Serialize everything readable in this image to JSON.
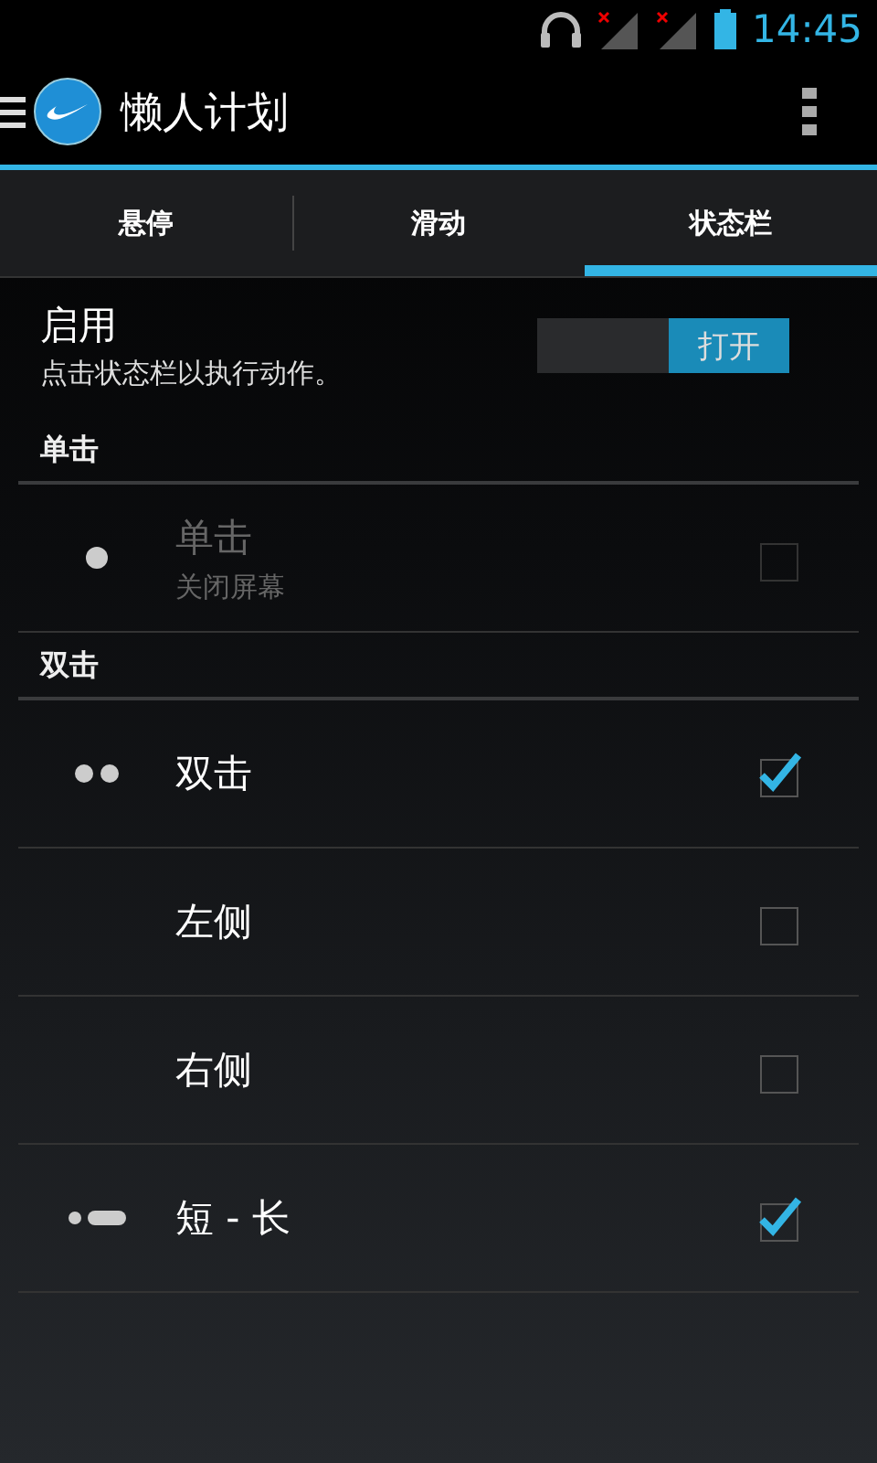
{
  "status_bar": {
    "time": "14:45"
  },
  "action_bar": {
    "title": "懒人计划"
  },
  "tabs": [
    {
      "label": "悬停",
      "selected": false
    },
    {
      "label": "滑动",
      "selected": false
    },
    {
      "label": "状态栏",
      "selected": true
    }
  ],
  "enable": {
    "title": "启用",
    "summary": "点击状态栏以执行动作。",
    "toggle": {
      "on": true,
      "label": "打开"
    }
  },
  "sections": [
    {
      "header": "单击",
      "items": [
        {
          "kind": "dot",
          "title": "单击",
          "summary": "关闭屏幕",
          "disabled": true,
          "checked": false
        }
      ]
    },
    {
      "header": "双击",
      "items": [
        {
          "kind": "double-dot",
          "title": "双击",
          "disabled": false,
          "checked": true
        },
        {
          "kind": "none",
          "title": "左侧",
          "disabled": false,
          "checked": false
        },
        {
          "kind": "none",
          "title": "右侧",
          "disabled": false,
          "checked": false
        },
        {
          "kind": "dot-dash",
          "title": "短 - 长",
          "disabled": false,
          "checked": true
        }
      ]
    }
  ]
}
